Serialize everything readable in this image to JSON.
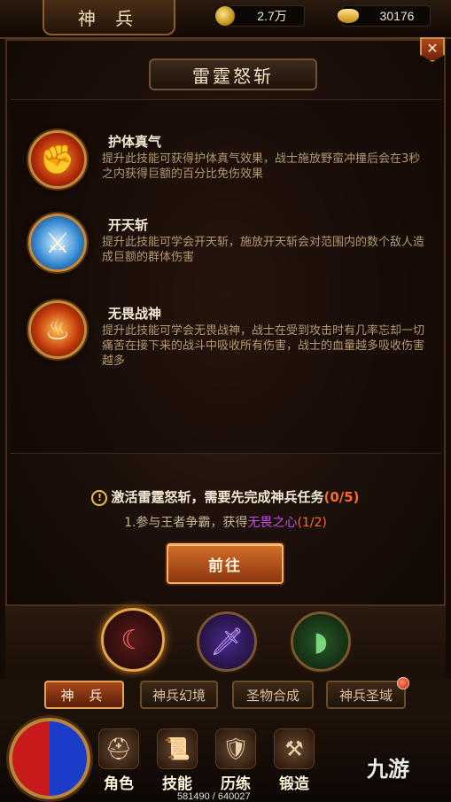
{
  "header": {
    "title": "神 兵",
    "gold": "2.7万",
    "ingot": "30176"
  },
  "skill": {
    "title": "雷霆怒斩",
    "entries": [
      {
        "name": "护体真气",
        "icon": "fire-fist-icon",
        "desc": "提升此技能可获得护体真气效果，战士施放野蛮冲撞后会在3秒之内获得巨额的百分比免伤效果"
      },
      {
        "name": "开天斩",
        "icon": "ice-blade-icon",
        "desc": "提升此技能可学会开天斩，施放开天斩会对范围内的数个敌人造成巨额的群体伤害"
      },
      {
        "name": "无畏战神",
        "icon": "rage-icon",
        "desc": "提升此技能可学会无畏战神，战士在受到攻击时有几率忘却一切痛苦在接下来的战斗中吸收所有伤害，战士的血量越多吸收伤害越多"
      }
    ]
  },
  "requirement": {
    "text": "激活雷霆怒斩，需要先完成神兵任务",
    "progress": "(0/5)",
    "task_prefix": "1.参与王者争霸，获得",
    "task_item": "无畏之心",
    "task_progress": "(1/2)"
  },
  "goto_label": "前往",
  "tabs": [
    {
      "label": "神 兵",
      "active": true
    },
    {
      "label": "神兵幻境"
    },
    {
      "label": "圣物合成"
    },
    {
      "label": "神兵圣域"
    }
  ],
  "nav": [
    {
      "label": "角色"
    },
    {
      "label": "技能"
    },
    {
      "label": "历练"
    },
    {
      "label": "锻造"
    }
  ],
  "exp_text": "581490 / 640027",
  "watermark": "九游"
}
